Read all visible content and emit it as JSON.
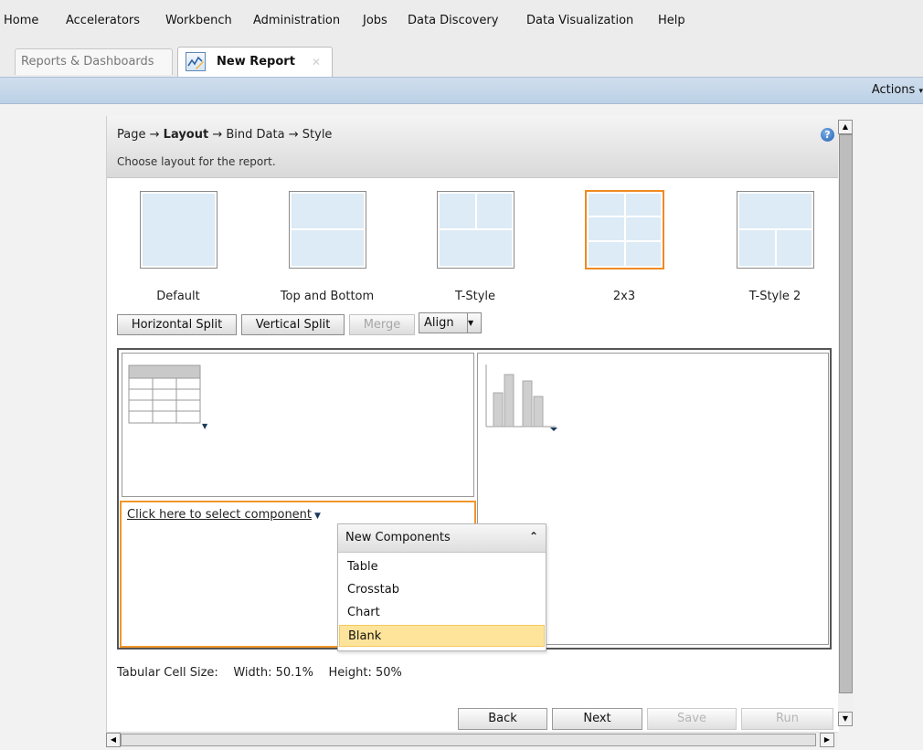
{
  "menu": {
    "items": [
      "Home",
      "Accelerators",
      "Workbench",
      "Administration",
      "Jobs",
      "Data Discovery",
      "Data Visualization",
      "Help"
    ]
  },
  "tabs": {
    "reports": "Reports & Dashboards",
    "new_report": "New Report"
  },
  "actions_label": "Actions",
  "wizard": {
    "steps": {
      "page": "Page",
      "layout": "Layout",
      "bind": "Bind Data",
      "style": "Style",
      "arrow": "→"
    },
    "subtitle": "Choose layout for the report."
  },
  "layouts": [
    "Default",
    "Top and Bottom",
    "T-Style",
    "2x3",
    "T-Style 2"
  ],
  "selected_layout": "2x3",
  "toolbar": {
    "horizontal_split": "Horizontal Split",
    "vertical_split": "Vertical Split",
    "merge": "Merge",
    "align": "Align"
  },
  "canvas": {
    "select_component": "Click here to select component"
  },
  "dropdown": {
    "title": "New Components",
    "items": [
      "Table",
      "Crosstab",
      "Chart",
      "Blank"
    ],
    "highlighted": "Blank"
  },
  "cell_size": {
    "label": "Tabular Cell Size:",
    "width": "Width: 50.1%",
    "height": "Height: 50%"
  },
  "nav": {
    "back": "Back",
    "next": "Next",
    "save": "Save",
    "run": "Run"
  },
  "colors": {
    "accent": "#f08a24",
    "header_band": "#c8d9ec",
    "highlight": "#fee49a"
  },
  "icons": [
    "report-chart-icon",
    "close-icon",
    "help-icon",
    "table-component-icon",
    "bar-chart-component-icon",
    "collapse-icon"
  ]
}
